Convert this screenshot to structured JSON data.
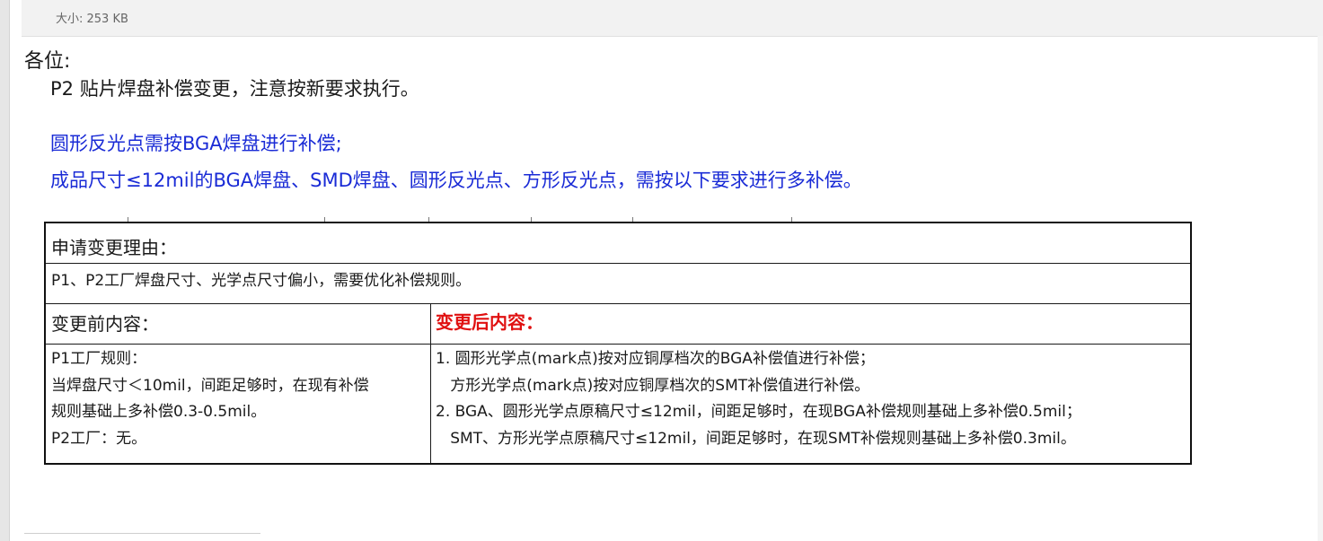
{
  "attachment": {
    "size_text": "大小: 253 KB"
  },
  "email": {
    "greeting": "各位:",
    "line1": "P2  贴片焊盘补偿变更，注意按新要求执行。",
    "blue_line1": "圆形反光点需按BGA焊盘进行补偿;",
    "blue_line2": "成品尺寸≤12mil的BGA焊盘、SMD焊盘、圆形反光点、方形反光点，需按以下要求进行多补偿。"
  },
  "table": {
    "reason_header": "申请变更理由：",
    "reason_text": "P1、P2工厂焊盘尺寸、光学点尺寸偏小，需要优化补偿规则。",
    "before_header": "变更前内容：",
    "after_header": "变更后内容：",
    "before_lines": [
      "P1工厂规则：",
      "当焊盘尺寸＜10mil，间距足够时，在现有补偿",
      "规则基础上多补偿0.3-0.5mil。",
      "P2工厂：无。"
    ],
    "after_lines": [
      "1. 圆形光学点(mark点)按对应铜厚档次的BGA补偿值进行补偿；",
      "   方形光学点(mark点)按对应铜厚档次的SMT补偿值进行补偿。",
      "2. BGA、圆形光学点原稿尺寸≤12mil，间距足够时，在现BGA补偿规则基础上多补偿0.5mil；",
      "   SMT、方形光学点原稿尺寸≤12mil，间距足够时，在现SMT补偿规则基础上多补偿0.3mil。"
    ]
  },
  "colors": {
    "blue_text": "#1a2bd6",
    "red_header": "#e01010"
  }
}
